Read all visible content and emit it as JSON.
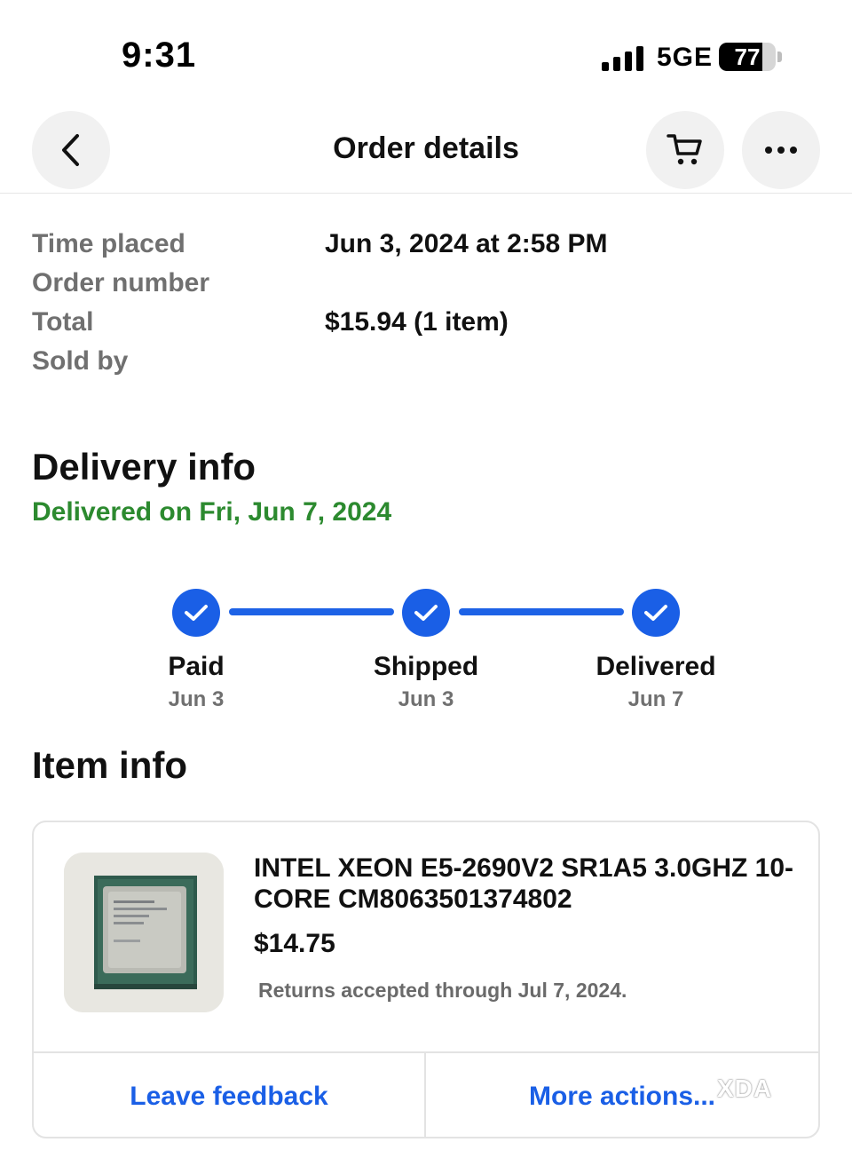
{
  "status_bar": {
    "time": "9:31",
    "network": "5GE",
    "battery_level": "77",
    "battery_fraction": 0.77
  },
  "header": {
    "title": "Order details",
    "back_icon": "chevron-left-icon",
    "cart_icon": "cart-icon",
    "more_icon": "ellipsis-icon"
  },
  "summary": {
    "rows": [
      {
        "label": "Time placed",
        "value": "Jun 3, 2024 at 2:58 PM"
      },
      {
        "label": "Order number",
        "value": ""
      },
      {
        "label": "Total",
        "value": "$15.94 (1 item)"
      },
      {
        "label": "Sold by",
        "value": ""
      }
    ]
  },
  "delivery": {
    "title": "Delivery info",
    "status": "Delivered on Fri, Jun 7, 2024",
    "status_color": "#2c8a2f",
    "accent_color": "#1a5fe6",
    "steps": [
      {
        "label": "Paid",
        "date": "Jun 3",
        "complete": true
      },
      {
        "label": "Shipped",
        "date": "Jun 3",
        "complete": true
      },
      {
        "label": "Delivered",
        "date": "Jun 7",
        "complete": true
      }
    ]
  },
  "item_info": {
    "title": "Item info",
    "item": {
      "name": "INTEL XEON E5-2690V2 SR1A5 3.0GHZ 10-CORE CM8063501374802",
      "price": "$14.75",
      "returns": "Returns accepted through Jul 7, 2024."
    },
    "actions": {
      "leave_feedback": "Leave feedback",
      "more_actions": "More actions..."
    }
  },
  "watermark": "XDA"
}
